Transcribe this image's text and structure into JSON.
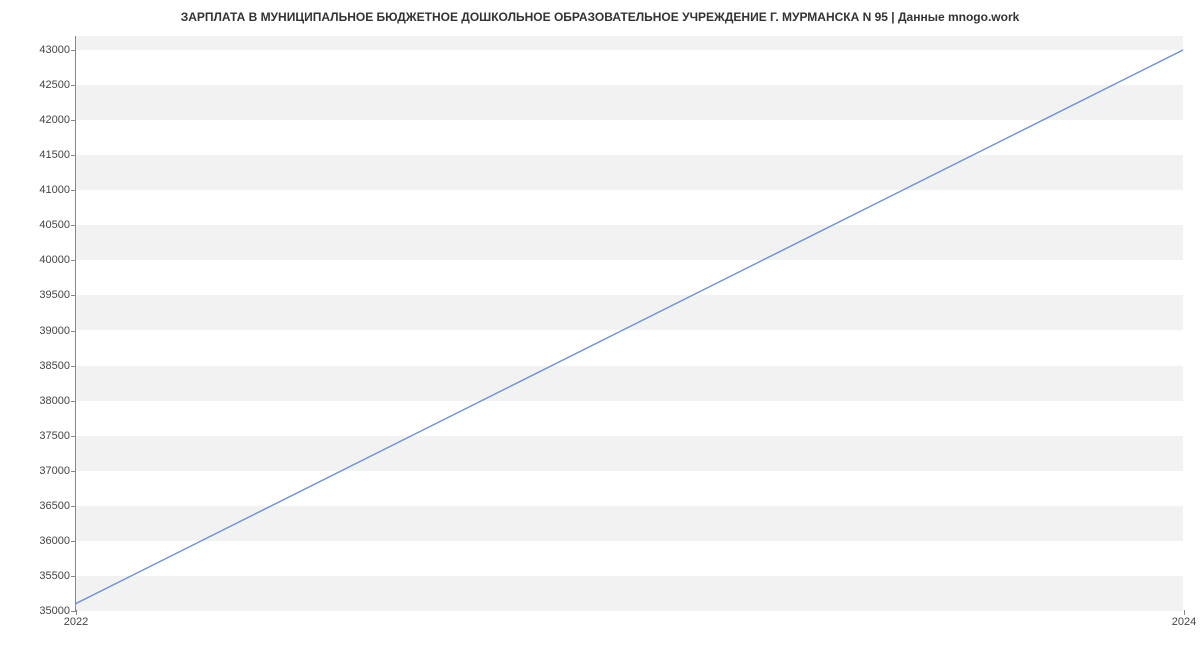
{
  "chart_data": {
    "type": "line",
    "title": "ЗАРПЛАТА В МУНИЦИПАЛЬНОЕ БЮДЖЕТНОЕ ДОШКОЛЬНОЕ ОБРАЗОВАТЕЛЬНОЕ УЧРЕЖДЕНИЕ Г. МУРМАНСКА N 95 | Данные mnogo.work",
    "xlabel": "",
    "ylabel": "",
    "x": [
      2022,
      2024
    ],
    "values": [
      35100,
      43000
    ],
    "x_ticks": [
      2022,
      2024
    ],
    "y_ticks": [
      35000,
      35500,
      36000,
      36500,
      37000,
      37500,
      38000,
      38500,
      39000,
      39500,
      40000,
      40500,
      41000,
      41500,
      42000,
      42500,
      43000
    ],
    "xlim": [
      2022,
      2024
    ],
    "ylim": [
      35000,
      43200
    ]
  }
}
